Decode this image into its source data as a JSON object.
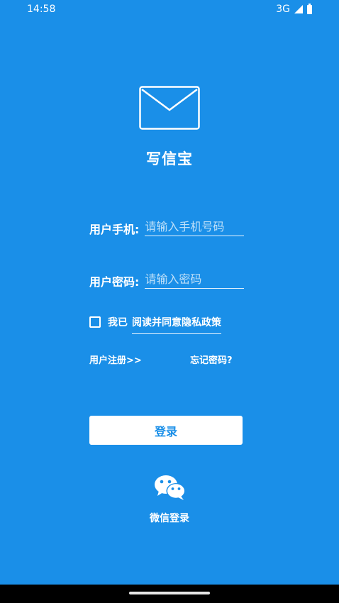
{
  "status_bar": {
    "time": "14:58",
    "network": "3G"
  },
  "app": {
    "title": "写信宝"
  },
  "form": {
    "phone": {
      "label": "用户手机:",
      "placeholder": "请输入手机号码"
    },
    "password": {
      "label": "用户密码:",
      "placeholder": "请输入密码"
    },
    "agree": {
      "prefix": "我已",
      "link": "阅读并同意隐私政策"
    }
  },
  "links": {
    "register": "用户注册>>",
    "forgot": "忘记密码?"
  },
  "login_button": {
    "label": "登录"
  },
  "wechat": {
    "label": "微信登录"
  },
  "colors": {
    "background": "#1a8fe8",
    "button_text": "#1a8fe8",
    "foreground": "#ffffff"
  },
  "icons": {
    "logo": "mail-icon",
    "wechat": "wechat-icon",
    "checkbox": "checkbox-unchecked"
  }
}
